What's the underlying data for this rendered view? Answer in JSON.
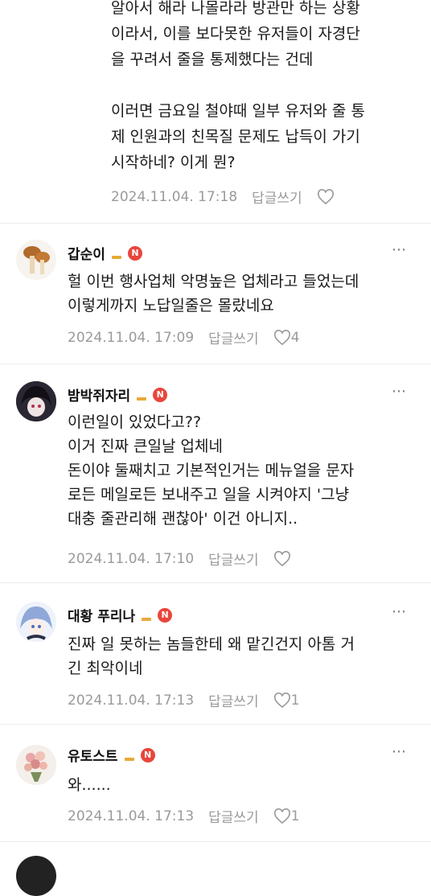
{
  "top_reply": {
    "text": "알아서 해라 나몰라라 방관만 하는 상황\n이라서, 이를 보다못한 유저들이 자경단\n을 꾸려서 줄을 통제했다는 건데\n\n이러면 금요일 철야때 일부 유저와 줄 통\n제 인원과의 친목질 문제도 납득이 가기\n시작하네? 이게 뭔?",
    "date": "2024.11.04. 17:18",
    "reply_label": "답글쓰기",
    "likes": ""
  },
  "comments": [
    {
      "nickname": "갑순이",
      "text": "헐 이번 행사업체 악명높은 업체라고 들었는데\n이렇게까지 노답일줄은 몰랐네요",
      "date": "2024.11.04. 17:09",
      "reply_label": "답글쓰기",
      "likes": "4",
      "avatar": "mushroom-avatar"
    },
    {
      "nickname": "밤박쥐자리",
      "text": "이런일이 있었다고??\n이거 진짜 큰일날 업체네\n돈이야 둘째치고 기본적인거는 메뉴얼을 문자\n로든 메일로든 보내주고 일을 시켜야지 '그냥\n대충 줄관리해 괜찮아' 이건 아니지..",
      "date": "2024.11.04. 17:10",
      "reply_label": "답글쓰기",
      "likes": "",
      "avatar": "anime-dark-avatar"
    },
    {
      "nickname": "대황 푸리나",
      "text": "진짜 일 못하는 놈들한테 왜 맡긴건지 아톰 거\n긴 최악이네",
      "date": "2024.11.04. 17:13",
      "reply_label": "답글쓰기",
      "likes": "1",
      "avatar": "anime-blue-avatar"
    },
    {
      "nickname": "유토스트",
      "text": "와......",
      "date": "2024.11.04. 17:13",
      "reply_label": "답글쓰기",
      "likes": "1",
      "avatar": "flower-avatar"
    }
  ],
  "badge_letter": "N",
  "more_icon": "⋯",
  "colors": {
    "badge": "#e8463c",
    "level": "#e8a93a",
    "meta": "#9a9a9a"
  }
}
